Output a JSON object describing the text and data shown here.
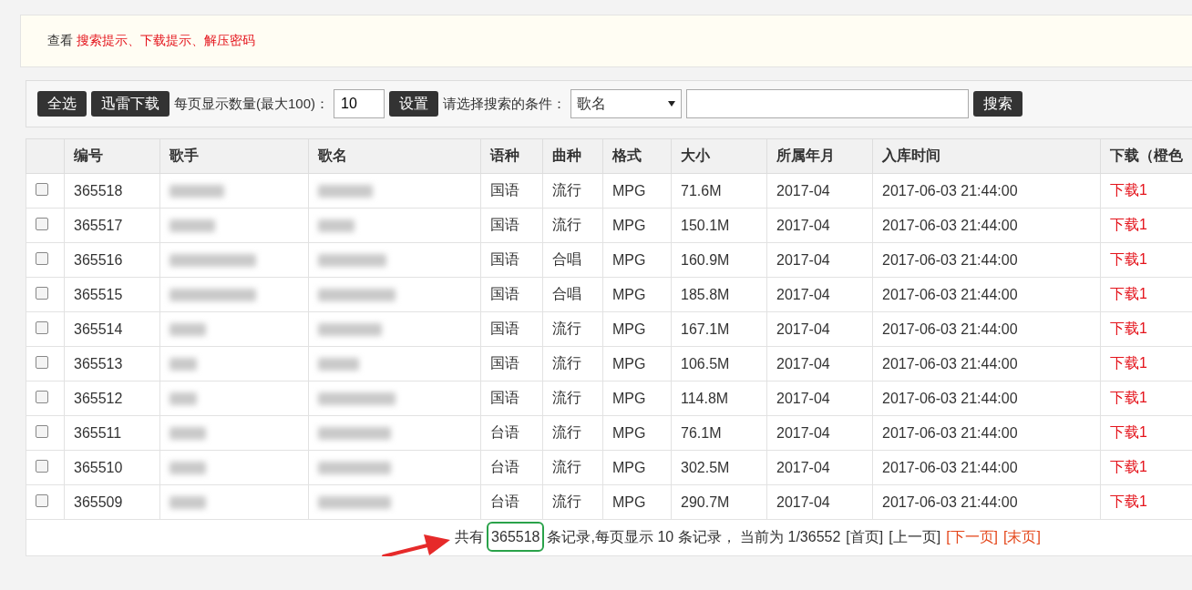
{
  "notice": {
    "prefix": "查看",
    "link": "搜索提示、下载提示、解压密码"
  },
  "toolbar": {
    "select_all": "全选",
    "thunder_download": "迅雷下载",
    "per_page_label": "每页显示数量(最大100)：",
    "per_page_value": "10",
    "set_button": "设置",
    "condition_label": "请选择搜索的条件：",
    "condition_value": "歌名",
    "search_button": "搜索"
  },
  "table": {
    "columns": [
      "",
      "编号",
      "歌手",
      "歌名",
      "语种",
      "曲种",
      "格式",
      "大小",
      "所属年月",
      "入库时间",
      "下载（橙色"
    ],
    "rows": [
      {
        "checked": false,
        "id": "365518",
        "language": "国语",
        "genre": "流行",
        "format": "MPG",
        "size": "71.6M",
        "month": "2017-04",
        "added": "2017-06-03 21:44:00",
        "download": "下载1"
      },
      {
        "checked": false,
        "id": "365517",
        "language": "国语",
        "genre": "流行",
        "format": "MPG",
        "size": "150.1M",
        "month": "2017-04",
        "added": "2017-06-03 21:44:00",
        "download": "下载1"
      },
      {
        "checked": false,
        "id": "365516",
        "language": "国语",
        "genre": "合唱",
        "format": "MPG",
        "size": "160.9M",
        "month": "2017-04",
        "added": "2017-06-03 21:44:00",
        "download": "下载1"
      },
      {
        "checked": false,
        "id": "365515",
        "language": "国语",
        "genre": "合唱",
        "format": "MPG",
        "size": "185.8M",
        "month": "2017-04",
        "added": "2017-06-03 21:44:00",
        "download": "下载1"
      },
      {
        "checked": false,
        "id": "365514",
        "language": "国语",
        "genre": "流行",
        "format": "MPG",
        "size": "167.1M",
        "month": "2017-04",
        "added": "2017-06-03 21:44:00",
        "download": "下载1"
      },
      {
        "checked": false,
        "id": "365513",
        "language": "国语",
        "genre": "流行",
        "format": "MPG",
        "size": "106.5M",
        "month": "2017-04",
        "added": "2017-06-03 21:44:00",
        "download": "下载1"
      },
      {
        "checked": false,
        "id": "365512",
        "language": "国语",
        "genre": "流行",
        "format": "MPG",
        "size": "114.8M",
        "month": "2017-04",
        "added": "2017-06-03 21:44:00",
        "download": "下载1"
      },
      {
        "checked": false,
        "id": "365511",
        "language": "台语",
        "genre": "流行",
        "format": "MPG",
        "size": "76.1M",
        "month": "2017-04",
        "added": "2017-06-03 21:44:00",
        "download": "下载1"
      },
      {
        "checked": false,
        "id": "365510",
        "language": "台语",
        "genre": "流行",
        "format": "MPG",
        "size": "302.5M",
        "month": "2017-04",
        "added": "2017-06-03 21:44:00",
        "download": "下载1"
      },
      {
        "checked": false,
        "id": "365509",
        "language": "台语",
        "genre": "流行",
        "format": "MPG",
        "size": "290.7M",
        "month": "2017-04",
        "added": "2017-06-03 21:44:00",
        "download": "下载1"
      }
    ]
  },
  "pager": {
    "prefix": "共有",
    "count": "365518",
    "summary": "条记录,每页显示 10 条记录， 当前为 1/36552",
    "links": [
      {
        "label": "[首页]",
        "enabled": false
      },
      {
        "label": "[上一页]",
        "enabled": false
      },
      {
        "label": "[下一页]",
        "enabled": true
      },
      {
        "label": "[末页]",
        "enabled": true
      }
    ]
  }
}
